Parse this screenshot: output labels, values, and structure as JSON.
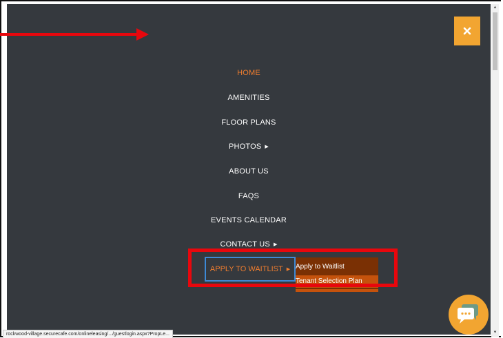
{
  "nav": {
    "items": [
      {
        "label": "HOME",
        "active": true,
        "has_submenu": false
      },
      {
        "label": "AMENITIES",
        "active": false,
        "has_submenu": false
      },
      {
        "label": "FLOOR PLANS",
        "active": false,
        "has_submenu": false
      },
      {
        "label": "PHOTOS",
        "active": false,
        "has_submenu": true
      },
      {
        "label": "ABOUT US",
        "active": false,
        "has_submenu": false
      },
      {
        "label": "FAQS",
        "active": false,
        "has_submenu": false
      },
      {
        "label": "EVENTS CALENDAR",
        "active": false,
        "has_submenu": false
      },
      {
        "label": "CONTACT US",
        "active": false,
        "has_submenu": true
      }
    ],
    "apply": {
      "label": "APPLY TO WAITLIST",
      "has_submenu": true
    },
    "submenu": [
      {
        "label": "Apply to Waitlist"
      },
      {
        "label": "Tenant Selection Plan"
      }
    ]
  },
  "close_button": {
    "icon": "close-icon"
  },
  "chat_button": {
    "icon": "chat-bubble-icon"
  },
  "status_bar": {
    "url": "rockwood-village.securecafe.com/onlineleasing/.../guestlogin.aspx?PropLe..."
  },
  "colors": {
    "menu_background": "#35393e",
    "accent_orange": "#ef7d2f",
    "close_button_bg": "#f2a531",
    "submenu_bg": "#7a3004",
    "submenu_highlight": "#c5520c",
    "annotation_red": "#e8070d",
    "focus_blue": "#3d8ad6"
  }
}
